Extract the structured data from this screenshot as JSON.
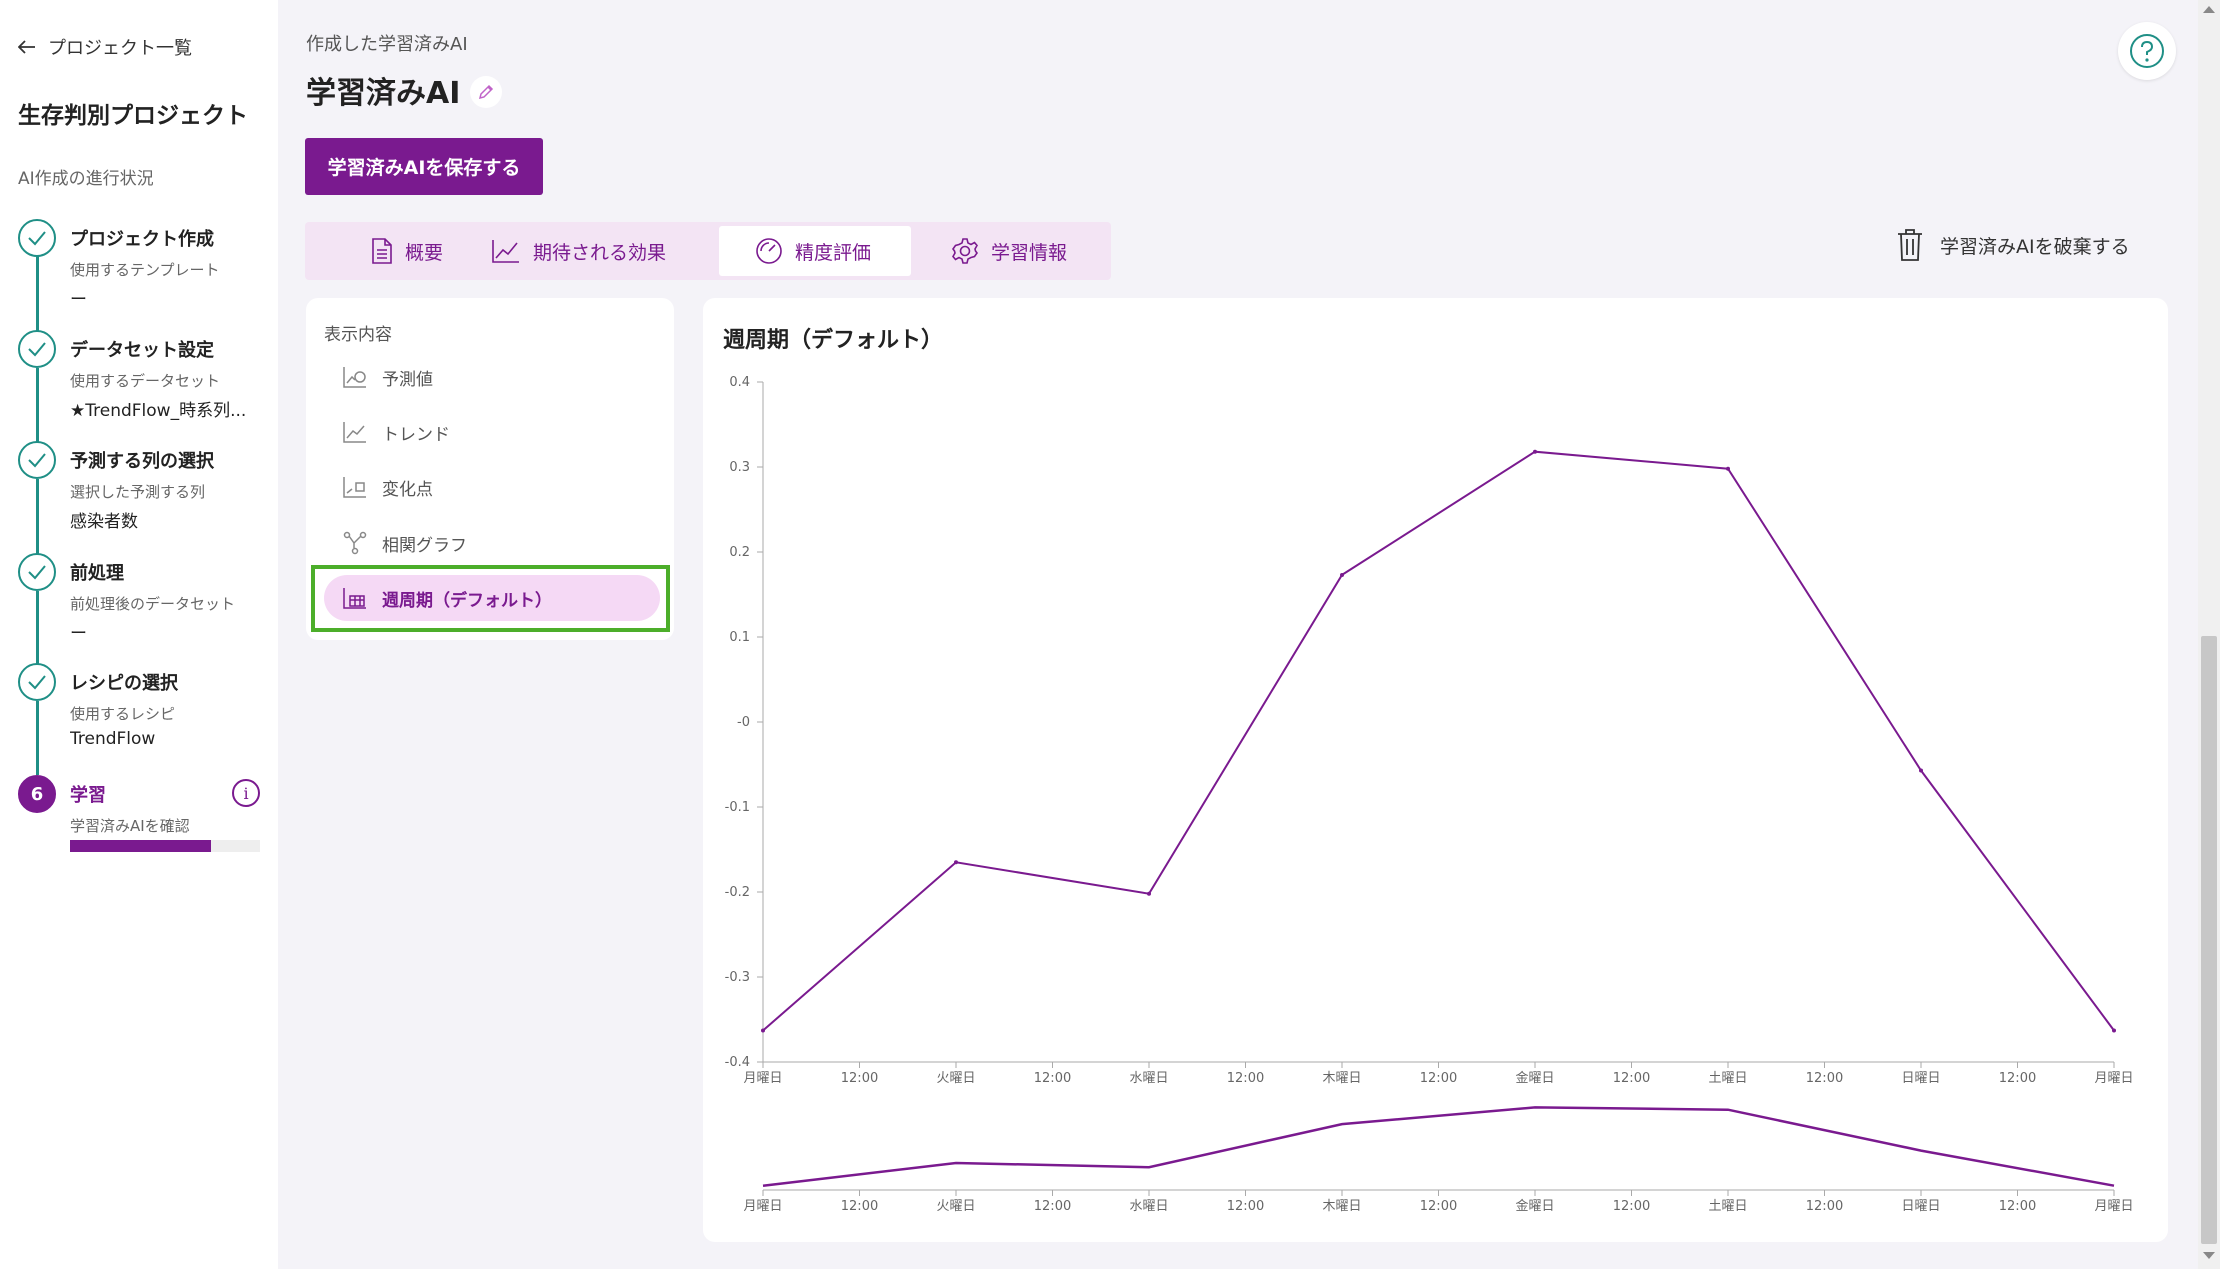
{
  "sidebar": {
    "back_label": "プロジェクト一覧",
    "project_name": "生存判別プロジェクト",
    "progress_heading": "AI作成の進行状況",
    "steps": [
      {
        "title": "プロジェクト作成",
        "sub": "使用するテンプレート",
        "value": "ー"
      },
      {
        "title": "データセット設定",
        "sub": "使用するデータセット",
        "value": "★TrendFlow_時系列..."
      },
      {
        "title": "予測する列の選択",
        "sub": "選択した予測する列",
        "value": "感染者数"
      },
      {
        "title": "前処理",
        "sub": "前処理後のデータセット",
        "value": "ー"
      },
      {
        "title": "レシピの選択",
        "sub": "使用するレシピ",
        "value": "TrendFlow"
      },
      {
        "number": "6",
        "title": "学習",
        "sub": "学習済みAIを確認",
        "progress": 0.74
      }
    ]
  },
  "header": {
    "breadcrumb": "作成した学習済みAI",
    "title": "学習済みAI",
    "save_label": "学習済みAIを保存する",
    "discard_label": "学習済みAIを破棄する"
  },
  "tabs": [
    {
      "label": "概要",
      "icon": "document-icon"
    },
    {
      "label": "期待される効果",
      "icon": "line-chart-icon"
    },
    {
      "label": "精度評価",
      "icon": "gauge-icon",
      "active": true
    },
    {
      "label": "学習情報",
      "icon": "gear-icon"
    }
  ],
  "display_options": {
    "heading": "表示内容",
    "items": [
      {
        "label": "予測値"
      },
      {
        "label": "トレンド"
      },
      {
        "label": "変化点"
      },
      {
        "label": "相関グラフ"
      },
      {
        "label": "週周期（デフォルト）",
        "selected": true
      }
    ]
  },
  "colors": {
    "accent": "#7a1a8f",
    "teal": "#1f8f86",
    "highlight": "#4cae2a"
  },
  "chart_data": {
    "type": "line",
    "title": "週周期（デフォルト）",
    "x": [
      "月曜日",
      "火曜日",
      "水曜日",
      "木曜日",
      "金曜日",
      "土曜日",
      "日曜日",
      "月曜日"
    ],
    "x_tick_labels": [
      "月曜日",
      "12:00",
      "火曜日",
      "12:00",
      "水曜日",
      "12:00",
      "木曜日",
      "12:00",
      "金曜日",
      "12:00",
      "土曜日",
      "12:00",
      "日曜日",
      "12:00",
      "月曜日"
    ],
    "y_tick_labels": [
      "0.4",
      "0.3",
      "0.2",
      "0.1",
      "-0",
      "-0.1",
      "-0.2",
      "-0.3",
      "-0.4"
    ],
    "series": [
      {
        "values": [
          -0.363,
          -0.165,
          -0.202,
          0.173,
          0.318,
          0.298,
          -0.057,
          -0.363
        ],
        "color": "#7a1a8f"
      }
    ],
    "ylim": [
      -0.4,
      0.4
    ],
    "grid": false,
    "overview_brush": true
  }
}
